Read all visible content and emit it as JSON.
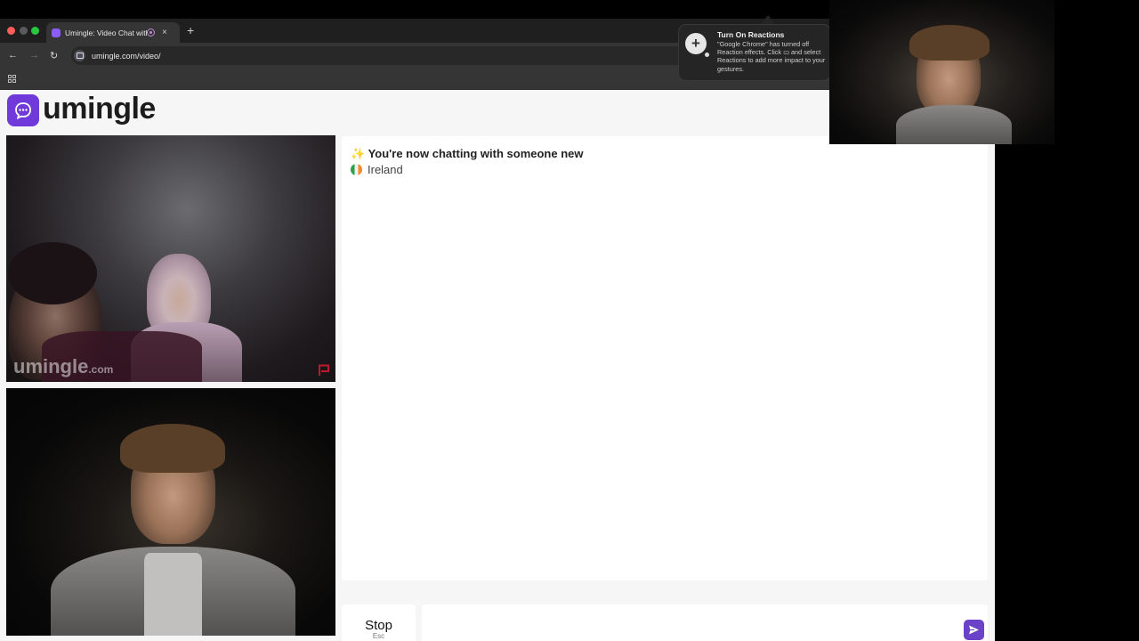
{
  "browser": {
    "tab": {
      "title": "Umingle: Video Chat with",
      "close": "×"
    },
    "new_tab": "+",
    "nav": {
      "back": "←",
      "forward": "→",
      "reload": "↻"
    },
    "url": "umingle.com/video/"
  },
  "page": {
    "logo_text": "umingle",
    "watermark": {
      "brand": "umingle",
      "suffix": ".com"
    },
    "chat": {
      "title": "You're now chatting with someone new",
      "sparkle": "✨",
      "country": "Ireland"
    },
    "controls": {
      "stop_label": "Stop",
      "esc_hint": "Esc",
      "message_placeholder": ""
    }
  },
  "popup": {
    "title": "Turn On Reactions",
    "body": "\"Google Chrome\" has turned off Reaction effects. Click ▭ and select Reactions to add more impact to your gestures."
  },
  "colors": {
    "brand": "#6f3ad9",
    "send": "#6b43c8"
  }
}
